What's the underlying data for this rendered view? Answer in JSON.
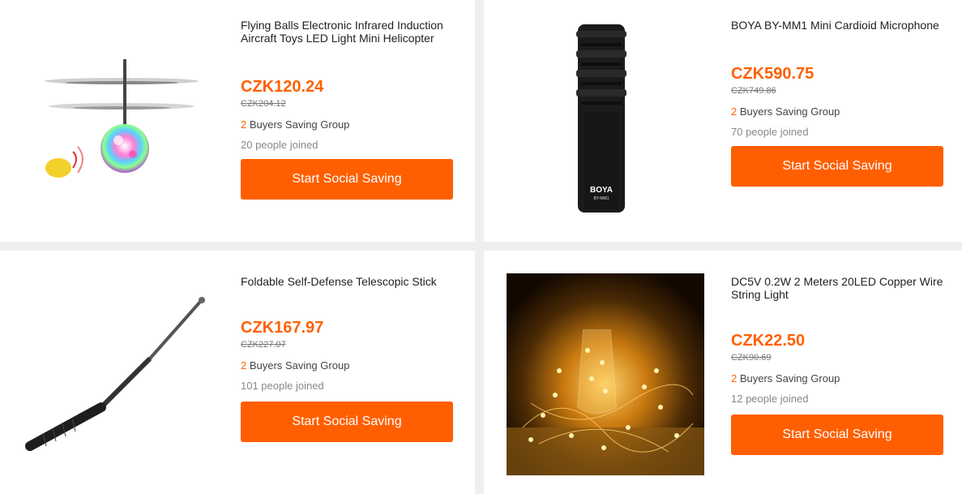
{
  "products": [
    {
      "title": "Flying Balls Electronic Infrared Induction Aircraft Toys LED Light Mini Helicopter",
      "price": "CZK120.24",
      "old_price": "CZK204.12",
      "group_count": "2",
      "group_label": " Buyers Saving Group",
      "joined": "20 people joined",
      "button": "Start Social Saving",
      "image": "flying-ball-helicopter-image"
    },
    {
      "title": "BOYA BY-MM1 Mini Cardioid Microphone",
      "price": "CZK590.75",
      "old_price": "CZK749.86",
      "group_count": "2",
      "group_label": " Buyers Saving Group",
      "joined": "70 people joined",
      "button": "Start Social Saving",
      "image": "microphone-image",
      "image_text": "BOYA",
      "image_subtext": "BY-MM1"
    },
    {
      "title": "Foldable Self-Defense Telescopic Stick",
      "price": "CZK167.97",
      "old_price": "CZK227.07",
      "group_count": "2",
      "group_label": " Buyers Saving Group",
      "joined": "101 people joined",
      "button": "Start Social Saving",
      "image": "telescopic-stick-image"
    },
    {
      "title": "DC5V 0.2W 2 Meters 20LED Copper Wire String Light",
      "price": "CZK22.50",
      "old_price": "CZK90.69",
      "group_count": "2",
      "group_label": " Buyers Saving Group",
      "joined": "12 people joined",
      "button": "Start Social Saving",
      "image": "string-light-image"
    }
  ],
  "colors": {
    "accent": "#ff6000",
    "button": "#ff5f00",
    "background": "#efefef"
  }
}
